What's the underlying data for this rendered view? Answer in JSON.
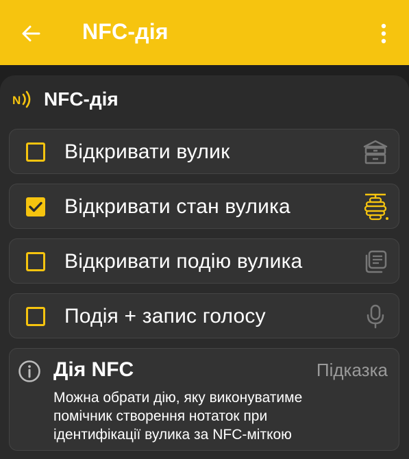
{
  "appbar": {
    "title": "NFC-дія",
    "back_icon": "arrow-left-icon",
    "menu_icon": "more-vertical-icon",
    "color": "#f6c40f"
  },
  "section": {
    "title": "NFC-дія",
    "icon": "nfc-icon"
  },
  "options": [
    {
      "label": "Відкривати вулик",
      "checked": false,
      "icon": "hive-box-icon"
    },
    {
      "label": "Відкривати стан вулика",
      "checked": true,
      "icon": "beehive-icon"
    },
    {
      "label": "Відкривати подію вулика",
      "checked": false,
      "icon": "notes-icon"
    },
    {
      "label": "Подія + запис голосу",
      "checked": false,
      "icon": "microphone-icon"
    }
  ],
  "hint": {
    "icon": "info-icon",
    "title": "Дія NFC",
    "tag": "Підказка",
    "text_lines": [
      "Можна обрати дію, яку виконуватиме",
      "помічник створення нотаток при",
      "ідентифікації вулика за NFC-міткою"
    ]
  }
}
